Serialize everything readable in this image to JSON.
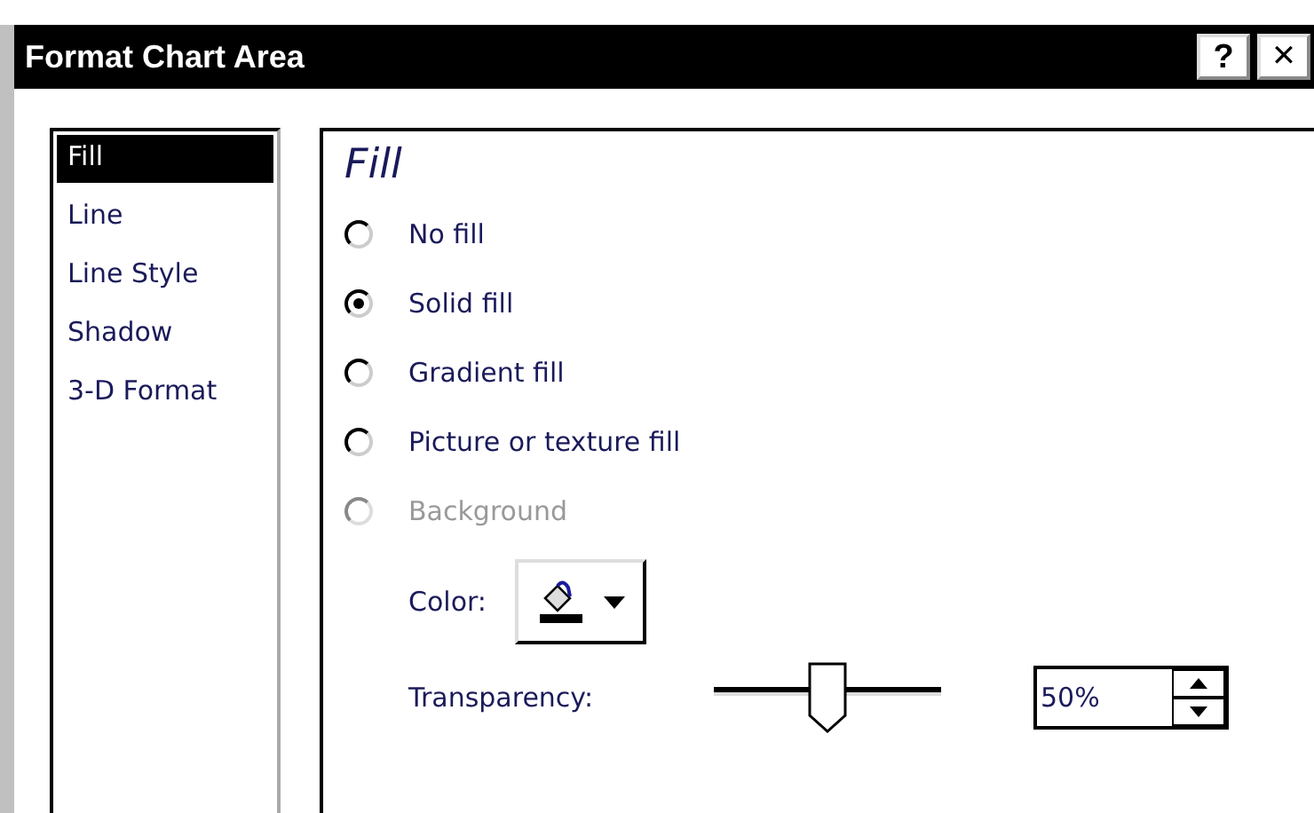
{
  "window": {
    "title": "Format Chart Area",
    "buttons": [
      {
        "kind": "help",
        "label": "?"
      },
      {
        "kind": "close",
        "label": "✕"
      }
    ]
  },
  "sidebar": {
    "items": [
      {
        "label": "Fill",
        "selected": true
      },
      {
        "label": "Line",
        "selected": false
      },
      {
        "label": "Line Style",
        "selected": false
      },
      {
        "label": "Shadow",
        "selected": false
      },
      {
        "label": "3-D Format",
        "selected": false
      }
    ]
  },
  "panel": {
    "heading": "Fill",
    "options": [
      {
        "label": "No fill",
        "selected": false,
        "disabled": false
      },
      {
        "label": "Solid fill",
        "selected": true,
        "disabled": false
      },
      {
        "label": "Gradient fill",
        "selected": false,
        "disabled": false
      },
      {
        "label": "Picture or texture fill",
        "selected": false,
        "disabled": false
      },
      {
        "label": "Background",
        "selected": false,
        "disabled": true
      }
    ],
    "color": {
      "label": "Color:"
    },
    "transparency": {
      "label": "Transparency:",
      "level": 0.5,
      "value": "50%"
    }
  }
}
